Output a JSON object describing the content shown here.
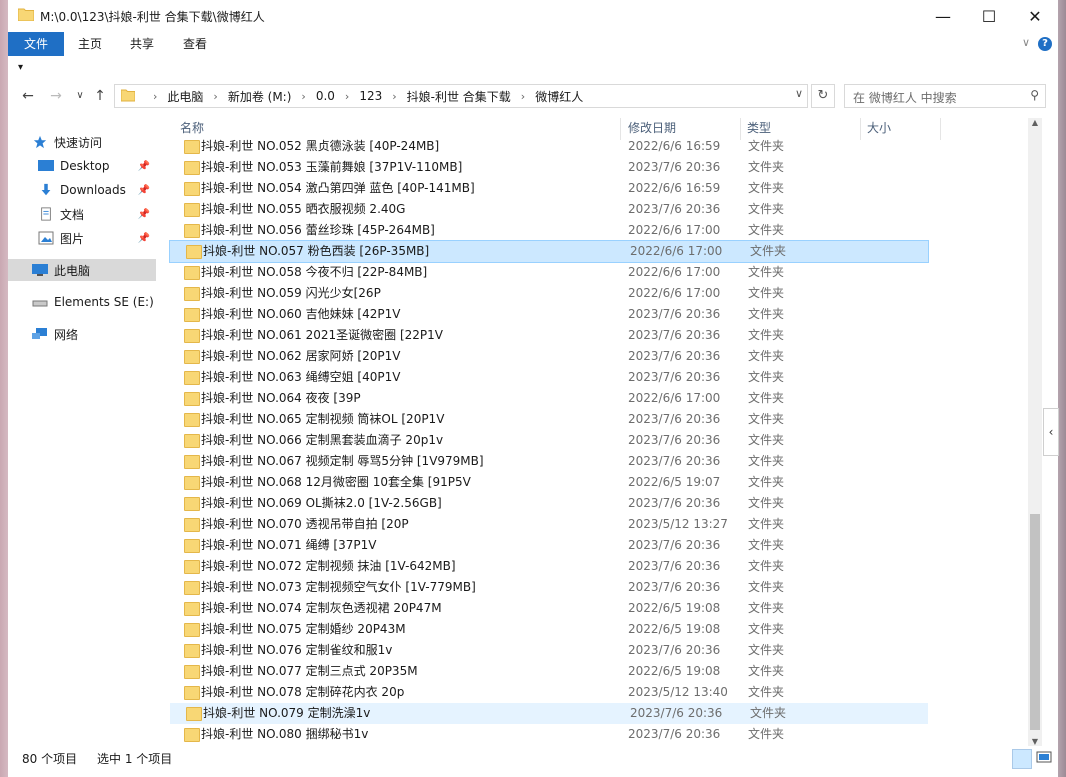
{
  "window": {
    "title": "M:\\0.0\\123\\抖娘-利世 合集下载\\微博红人",
    "minimize": "—",
    "maximize": "☐",
    "close": "✕"
  },
  "ribbon": {
    "tabs": [
      "文件",
      "主页",
      "共享",
      "查看"
    ],
    "help": "?"
  },
  "addressbar": {
    "crumbs": [
      "此电脑",
      "新加卷 (M:)",
      "0.0",
      "123",
      "抖娘-利世 合集下载",
      "微博红人"
    ],
    "search_placeholder": "在 微博红人 中搜索"
  },
  "nav": {
    "items": [
      {
        "label": "快速访问",
        "icon": "star-icon"
      },
      {
        "label": "Desktop",
        "icon": "desktop-icon",
        "pinned": true
      },
      {
        "label": "Downloads",
        "icon": "download-icon",
        "pinned": true
      },
      {
        "label": "文档",
        "icon": "document-icon",
        "pinned": true
      },
      {
        "label": "图片",
        "icon": "picture-icon",
        "pinned": true
      },
      {
        "label": "此电脑",
        "icon": "computer-icon"
      },
      {
        "label": "Elements SE (E:)",
        "icon": "drive-icon"
      },
      {
        "label": "网络",
        "icon": "network-icon"
      }
    ]
  },
  "columns": {
    "name": "名称",
    "date": "修改日期",
    "type": "类型",
    "size": "大小"
  },
  "files": [
    {
      "name": "抖娘-利世 NO.052 黑贞德泳装 [40P-24MB]",
      "date": "2022/6/6 16:59",
      "type": "文件夹"
    },
    {
      "name": "抖娘-利世 NO.053 玉藻前舞娘 [37P1V-110MB]",
      "date": "2023/7/6 20:36",
      "type": "文件夹"
    },
    {
      "name": "抖娘-利世 NO.054 激凸第四弹 蓝色 [40P-141MB]",
      "date": "2022/6/6 16:59",
      "type": "文件夹"
    },
    {
      "name": "抖娘-利世 NO.055 晒衣服视频 2.40G",
      "date": "2023/7/6 20:36",
      "type": "文件夹"
    },
    {
      "name": "抖娘-利世 NO.056 蕾丝珍珠 [45P-264MB]",
      "date": "2022/6/6 17:00",
      "type": "文件夹"
    },
    {
      "name": "抖娘-利世 NO.057 粉色西装 [26P-35MB]",
      "date": "2022/6/6 17:00",
      "type": "文件夹",
      "selected": true
    },
    {
      "name": "抖娘-利世 NO.058 今夜不归 [22P-84MB]",
      "date": "2022/6/6 17:00",
      "type": "文件夹"
    },
    {
      "name": "抖娘-利世 NO.059 闪光少女[26P",
      "date": "2022/6/6 17:00",
      "type": "文件夹"
    },
    {
      "name": "抖娘-利世 NO.060 吉他妹妹 [42P1V",
      "date": "2023/7/6 20:36",
      "type": "文件夹"
    },
    {
      "name": "抖娘-利世 NO.061 2021圣诞微密圈 [22P1V",
      "date": "2023/7/6 20:36",
      "type": "文件夹"
    },
    {
      "name": "抖娘-利世 NO.062 居家阿娇 [20P1V",
      "date": "2023/7/6 20:36",
      "type": "文件夹"
    },
    {
      "name": "抖娘-利世 NO.063 绳缚空姐 [40P1V",
      "date": "2023/7/6 20:36",
      "type": "文件夹"
    },
    {
      "name": "抖娘-利世 NO.064 夜夜 [39P",
      "date": "2022/6/6 17:00",
      "type": "文件夹"
    },
    {
      "name": "抖娘-利世 NO.065 定制视频  筒袜OL [20P1V",
      "date": "2023/7/6 20:36",
      "type": "文件夹"
    },
    {
      "name": "抖娘-利世 NO.066 定制黑套装血滴子 20p1v",
      "date": "2023/7/6 20:36",
      "type": "文件夹"
    },
    {
      "name": "抖娘-利世 NO.067 视频定制 辱骂5分钟 [1V979MB]",
      "date": "2023/7/6 20:36",
      "type": "文件夹"
    },
    {
      "name": "抖娘-利世 NO.068 12月微密圈 10套全集 [91P5V",
      "date": "2022/6/5 19:07",
      "type": "文件夹"
    },
    {
      "name": "抖娘-利世 NO.069 OL撕袜2.0 [1V-2.56GB]",
      "date": "2023/7/6 20:36",
      "type": "文件夹"
    },
    {
      "name": "抖娘-利世 NO.070 透视吊带自拍 [20P",
      "date": "2023/5/12 13:27",
      "type": "文件夹"
    },
    {
      "name": "抖娘-利世 NO.071 绳缚 [37P1V",
      "date": "2023/7/6 20:36",
      "type": "文件夹"
    },
    {
      "name": "抖娘-利世 NO.072 定制视频 抹油 [1V-642MB]",
      "date": "2023/7/6 20:36",
      "type": "文件夹"
    },
    {
      "name": "抖娘-利世 NO.073 定制视频空气女仆 [1V-779MB]",
      "date": "2023/7/6 20:36",
      "type": "文件夹"
    },
    {
      "name": "抖娘-利世 NO.074 定制灰色透视裙 20P47M",
      "date": "2022/6/5 19:08",
      "type": "文件夹"
    },
    {
      "name": "抖娘-利世 NO.075 定制婚纱 20P43M",
      "date": "2022/6/5 19:08",
      "type": "文件夹"
    },
    {
      "name": "抖娘-利世 NO.076 定制雀纹和服1v",
      "date": "2023/7/6 20:36",
      "type": "文件夹"
    },
    {
      "name": "抖娘-利世 NO.077 定制三点式 20P35M",
      "date": "2022/6/5 19:08",
      "type": "文件夹"
    },
    {
      "name": "抖娘-利世 NO.078 定制碎花内衣 20p",
      "date": "2023/5/12 13:40",
      "type": "文件夹"
    },
    {
      "name": "抖娘-利世 NO.079 定制洗澡1v",
      "date": "2023/7/6 20:36",
      "type": "文件夹",
      "hover": true
    },
    {
      "name": "抖娘-利世 NO.080 捆绑秘书1v",
      "date": "2023/7/6 20:36",
      "type": "文件夹"
    }
  ],
  "status": {
    "count": "80 个项目",
    "selected": "选中 1 个项目"
  },
  "colors": {
    "accent": "#1f6fc5",
    "selection": "#cce8ff",
    "hover": "#e5f3ff",
    "folder": "#f8d775"
  }
}
